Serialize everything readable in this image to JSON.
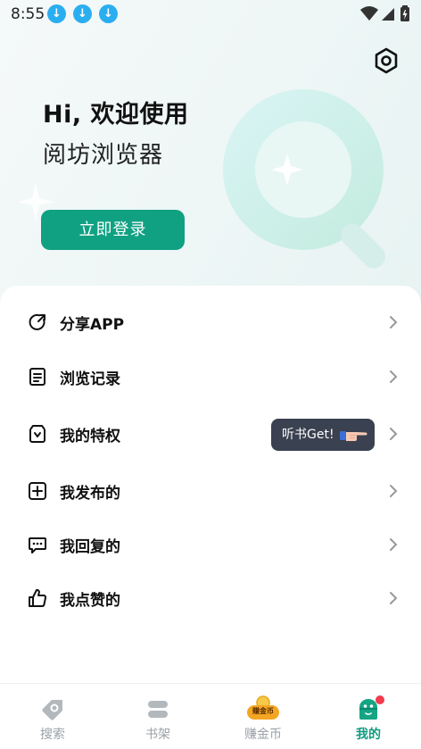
{
  "status_bar": {
    "time": "8:55"
  },
  "header": {
    "greeting": "Hi, 欢迎使用",
    "app_name": "阅坊浏览器",
    "login_button": "立即登录"
  },
  "menu": {
    "items": [
      {
        "label": "分享APP",
        "icon": "share-icon"
      },
      {
        "label": "浏览记录",
        "icon": "history-icon"
      },
      {
        "label": "我的特权",
        "icon": "privilege-icon"
      },
      {
        "label": "我发布的",
        "icon": "add-post-icon"
      },
      {
        "label": "我回复的",
        "icon": "reply-icon"
      },
      {
        "label": "我点赞的",
        "icon": "thumb-up-icon"
      }
    ],
    "privilege_tooltip": "听书Get!"
  },
  "tabbar": {
    "tabs": [
      {
        "label": "搜索",
        "icon": "search-tag-icon"
      },
      {
        "label": "书架",
        "icon": "bookshelf-icon"
      },
      {
        "label": "赚金币",
        "icon": "coin-icon",
        "badge": "赚金币"
      },
      {
        "label": "我的",
        "icon": "profile-icon"
      }
    ],
    "active": "我的"
  },
  "colors": {
    "accent": "#10a182",
    "tooltip_bg": "#3a4150",
    "badge_red": "#f23b4d"
  }
}
